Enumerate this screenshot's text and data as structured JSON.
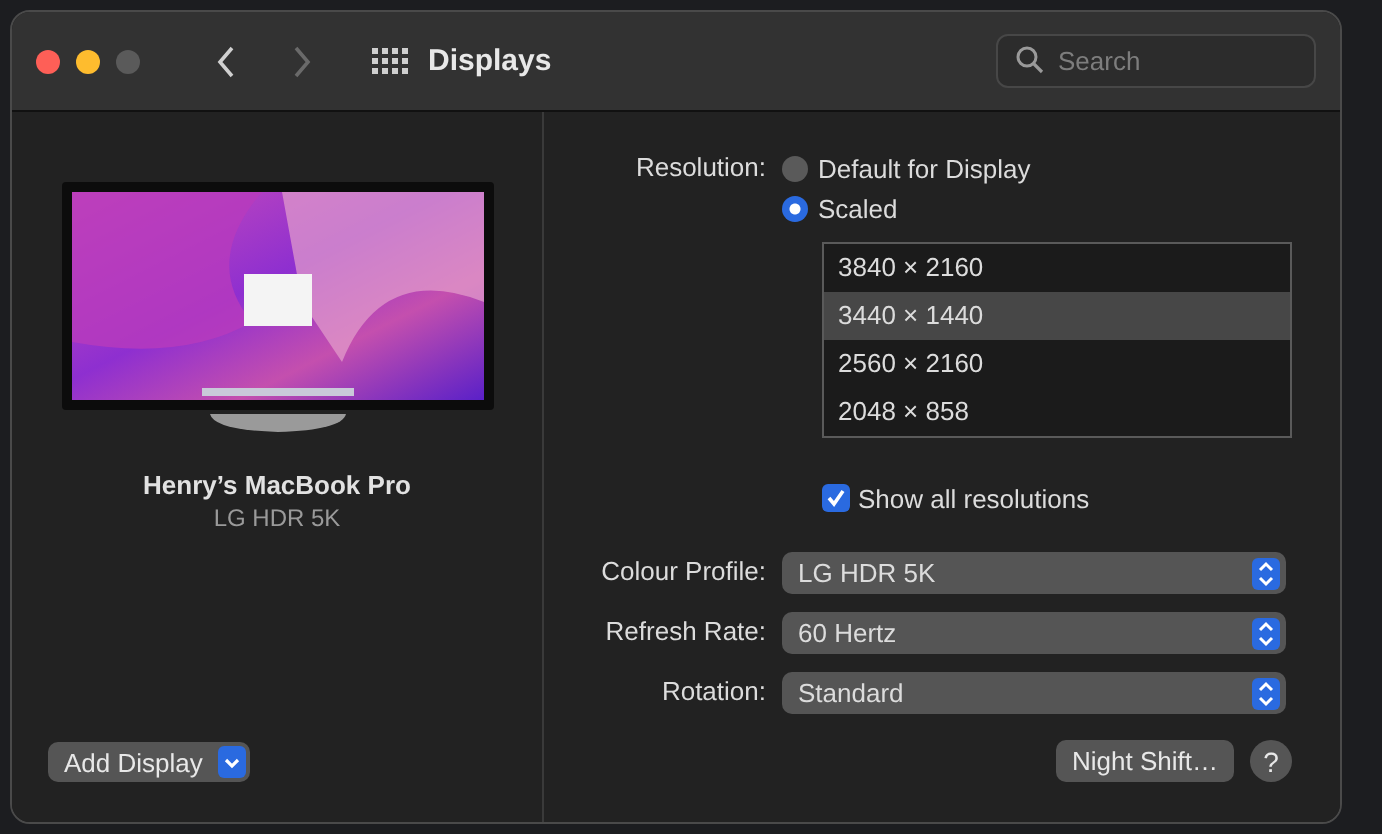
{
  "window": {
    "title": "Displays"
  },
  "nav": {
    "back_disabled": false,
    "forward_disabled": true
  },
  "search": {
    "placeholder": "Search"
  },
  "display": {
    "name": "Henry’s MacBook Pro",
    "model": "LG HDR 5K"
  },
  "resolution": {
    "label": "Resolution:",
    "options": [
      {
        "label": "Default for Display",
        "selected": false
      },
      {
        "label": "Scaled",
        "selected": true
      }
    ],
    "sizes": [
      {
        "label": "3840 × 2160",
        "selected": false
      },
      {
        "label": "3440 × 1440",
        "selected": true
      },
      {
        "label": "2560 × 2160",
        "selected": false
      },
      {
        "label": "2048 × 858",
        "selected": false
      }
    ],
    "show_all": {
      "label": "Show all resolutions",
      "checked": true
    }
  },
  "popups": [
    {
      "label": "Colour Profile:",
      "value": "LG HDR 5K"
    },
    {
      "label": "Refresh Rate:",
      "value": "60 Hertz"
    },
    {
      "label": "Rotation:",
      "value": "Standard"
    }
  ],
  "buttons": {
    "add_display": "Add Display",
    "night_shift": "Night Shift…",
    "help": "?"
  }
}
